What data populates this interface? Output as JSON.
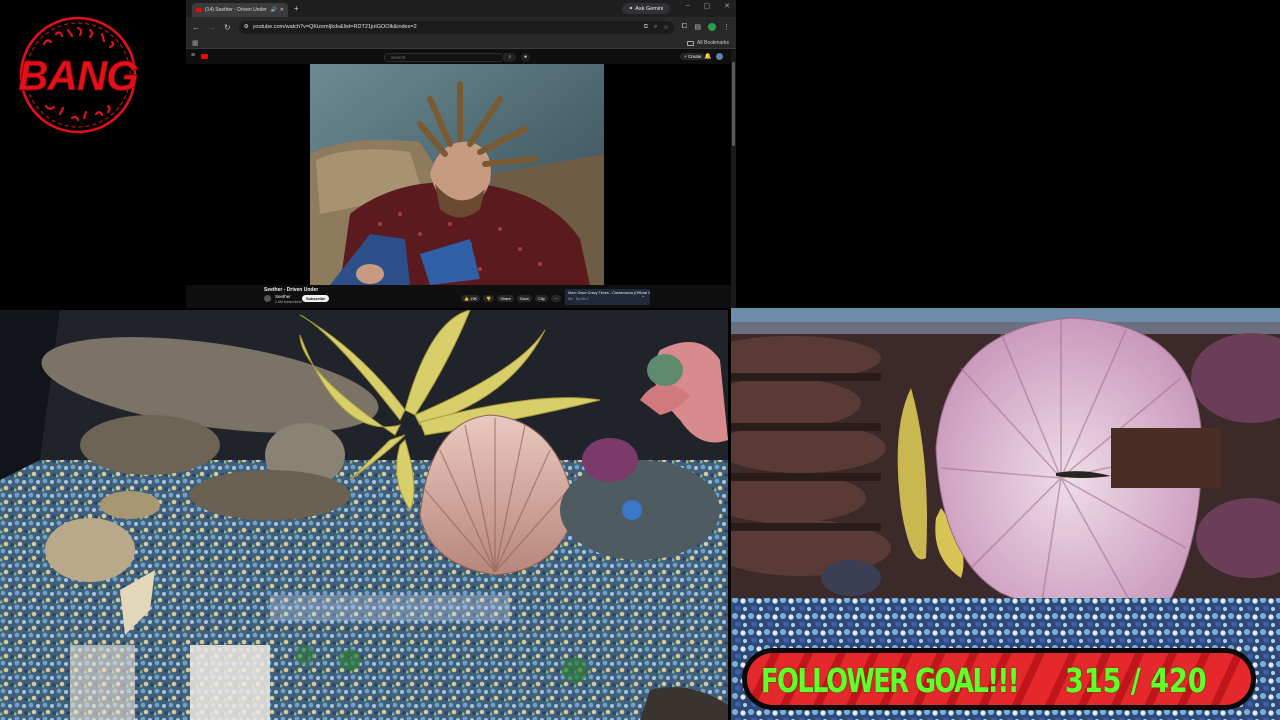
{
  "logo": {
    "text": "BANG",
    "top_script": "ジバネヨウイチ",
    "bottom_script": "きこえんよ",
    "color": "#e3101c"
  },
  "browser": {
    "tab_title": "(14) Seether - Driven Under",
    "new_tab_icon": "plus-icon",
    "gemini_label": "Ask Gemini",
    "url": "youtube.com/watch?v=QKizemIjkds&list=RDT21joIGOOlk&index=2",
    "bookmarks_label": "All Bookmarks"
  },
  "youtube": {
    "search_placeholder": "Search",
    "create_label": "+ Create",
    "video_title": "Seether - Driven Under",
    "channel_name": "Seether",
    "channel_subs": "2.6M subscribers",
    "subscribe_label": "Subscribe",
    "actions": {
      "like": "👍 19K",
      "dislike": "👎",
      "share": "Share",
      "save": "Save",
      "clip": "Clip",
      "more": "···"
    },
    "up_next_title": "Mom Once Crazy Times - Cantarosora (Official Vid...",
    "up_next_sub": "Mix · My Mix 2"
  },
  "follower_goal": {
    "label": "FOLLOWER GOAL!!!",
    "current": 315,
    "target": 420,
    "count_text": "315 / 420",
    "text_color": "#63ff2c",
    "bar_color": "#e4282c"
  }
}
